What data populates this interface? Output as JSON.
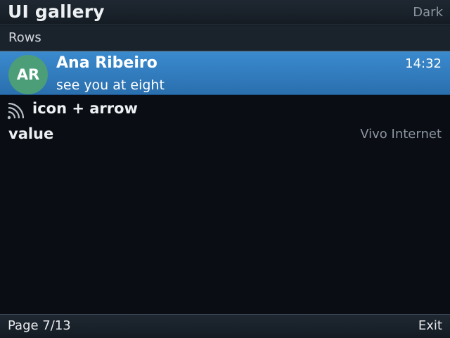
{
  "titlebar": {
    "title": "UI gallery",
    "theme": "Dark"
  },
  "section": {
    "label": "Rows"
  },
  "rows": {
    "contact": {
      "avatar_initials": "AR",
      "avatar_color": "#4c9e79",
      "name": "Ana Ribeiro",
      "time": "14:32",
      "message": "see you at eight",
      "selected": true
    },
    "icon_row": {
      "icon": "rss-icon",
      "label": "icon + arrow"
    },
    "value_row": {
      "label": "value",
      "value": "Vivo Internet"
    }
  },
  "softkeys": {
    "left": "Page 7/13",
    "right": "Exit"
  },
  "colors": {
    "selection": "#2a6fae",
    "background": "#0a0e14",
    "secondary_text": "#8c96a0"
  }
}
